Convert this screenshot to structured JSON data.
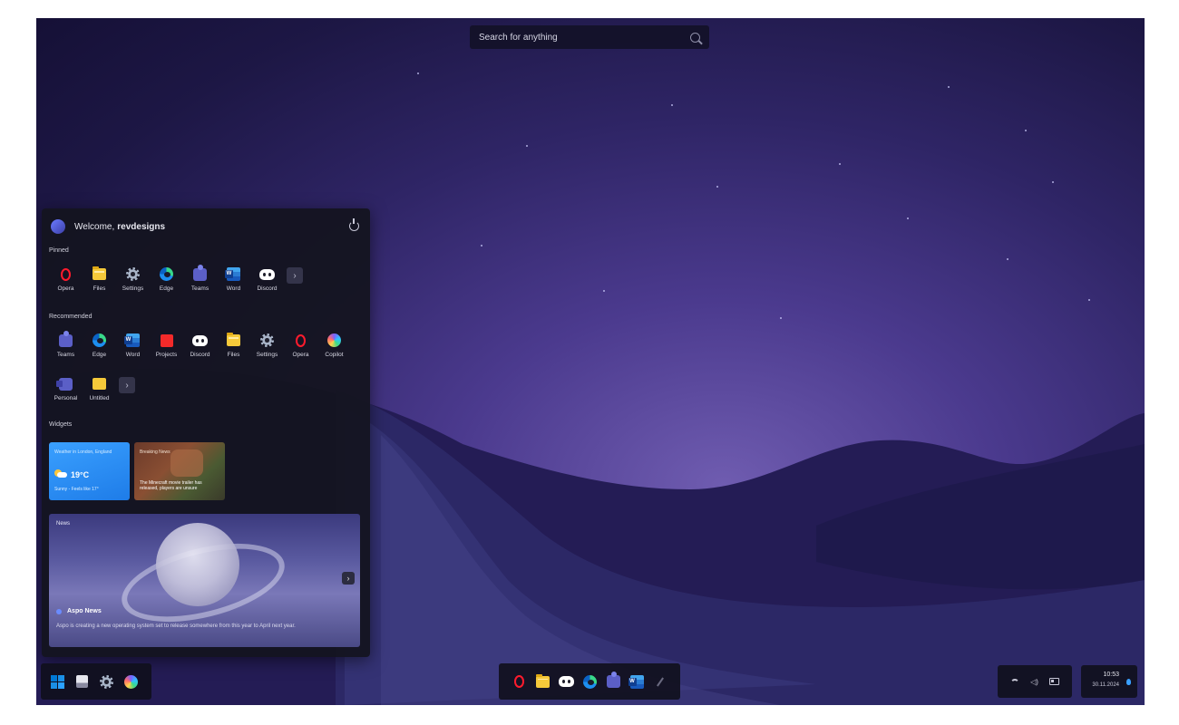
{
  "search": {
    "placeholder": "Search for anything"
  },
  "start_menu": {
    "welcome_prefix": "Welcome,",
    "username": "revdesigns",
    "pinned_heading": "Pinned",
    "pinned": [
      {
        "label": "Opera",
        "icon": "opera-icon"
      },
      {
        "label": "Files",
        "icon": "files-icon"
      },
      {
        "label": "Settings",
        "icon": "settings-icon"
      },
      {
        "label": "Edge",
        "icon": "edge-icon"
      },
      {
        "label": "Teams",
        "icon": "teams-icon"
      },
      {
        "label": "Word",
        "icon": "word-icon"
      },
      {
        "label": "Discord",
        "icon": "discord-icon"
      }
    ],
    "recommended_heading": "Recommended",
    "recommended": [
      {
        "label": "Teams",
        "icon": "teams-icon"
      },
      {
        "label": "Edge",
        "icon": "edge-icon"
      },
      {
        "label": "Word",
        "icon": "word-icon"
      },
      {
        "label": "Projects",
        "icon": "projects-icon"
      },
      {
        "label": "Discord",
        "icon": "discord-icon"
      },
      {
        "label": "Files",
        "icon": "files-icon"
      },
      {
        "label": "Settings",
        "icon": "settings-icon"
      },
      {
        "label": "Opera",
        "icon": "opera-icon"
      },
      {
        "label": "Copilot",
        "icon": "copilot-icon"
      },
      {
        "label": "Personal",
        "icon": "personal-icon"
      },
      {
        "label": "Untitled",
        "icon": "untitled-folder-icon"
      }
    ],
    "widgets_heading": "Widgets",
    "weather": {
      "location": "Weather in London, England",
      "temperature": "19°C",
      "description": "Sunny - Feels like 17°"
    },
    "breaking": {
      "label": "Breaking News",
      "headline": "The Minecraft movie trailer has released, players are unsure"
    },
    "news": {
      "label": "News",
      "source": "Aspo News",
      "description": "Aspo is creating a new operating system set to release somewhere from this year to April next year."
    }
  },
  "taskbar": {
    "left": [
      "start-icon",
      "file-explorer-icon",
      "settings-icon",
      "copilot-icon"
    ],
    "center": [
      "opera-icon",
      "files-icon",
      "discord-icon",
      "edge-icon",
      "teams-icon",
      "word-icon",
      "pen-icon"
    ],
    "tray": [
      "wifi-icon",
      "volume-icon",
      "battery-icon"
    ],
    "time": "10:53",
    "date": "30.11.2024"
  },
  "colors": {
    "accent": "#1e7ce8",
    "opera_red": "#ff1b2d",
    "wallpaper_deep": "#1d1745",
    "wallpaper_glow": "#6f5cb0"
  }
}
